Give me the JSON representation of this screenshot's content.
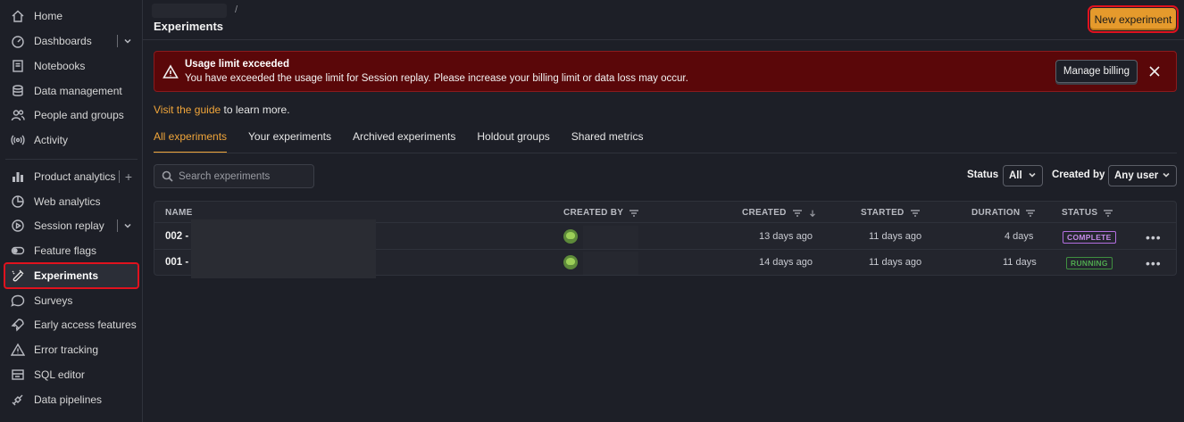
{
  "sidebar": {
    "items": [
      {
        "label": "Home",
        "icon": "home-icon"
      },
      {
        "label": "Dashboards",
        "icon": "dashboard-icon"
      },
      {
        "label": "Notebooks",
        "icon": "notebook-icon"
      },
      {
        "label": "Data management",
        "icon": "database-icon"
      },
      {
        "label": "People and groups",
        "icon": "people-icon"
      },
      {
        "label": "Activity",
        "icon": "activity-icon"
      },
      {
        "label": "Product analytics",
        "icon": "bar-chart-icon"
      },
      {
        "label": "Web analytics",
        "icon": "pie-chart-icon"
      },
      {
        "label": "Session replay",
        "icon": "play-icon"
      },
      {
        "label": "Feature flags",
        "icon": "toggle-icon"
      },
      {
        "label": "Experiments",
        "icon": "flask-icon"
      },
      {
        "label": "Surveys",
        "icon": "chat-icon"
      },
      {
        "label": "Early access features",
        "icon": "rocket-icon"
      },
      {
        "label": "Error tracking",
        "icon": "warning-icon"
      },
      {
        "label": "SQL editor",
        "icon": "sql-icon"
      },
      {
        "label": "Data pipelines",
        "icon": "pipeline-icon"
      }
    ]
  },
  "header": {
    "breadcrumb_sep": "/",
    "title": "Experiments",
    "new_button": "New experiment"
  },
  "alert": {
    "title": "Usage limit exceeded",
    "text": "You have exceeded the usage limit for Session replay. Please increase your billing limit or data loss may occur.",
    "button": "Manage billing"
  },
  "guide": {
    "link": "Visit the guide",
    "rest": " to learn more."
  },
  "tabs": [
    "All experiments",
    "Your experiments",
    "Archived experiments",
    "Holdout groups",
    "Shared metrics"
  ],
  "filters": {
    "search_placeholder": "Search experiments",
    "status_label": "Status",
    "status_value": "All",
    "created_by_label": "Created by",
    "created_by_value": "Any user"
  },
  "table": {
    "columns": [
      "NAME",
      "CREATED BY",
      "CREATED",
      "STARTED",
      "DURATION",
      "STATUS"
    ],
    "rows": [
      {
        "name": "002 -",
        "created": "13 days ago",
        "started": "11 days ago",
        "duration": "4 days",
        "status": "COMPLETE"
      },
      {
        "name": "001 -",
        "created": "14 days ago",
        "started": "11 days ago",
        "duration": "11 days",
        "status": "RUNNING"
      }
    ]
  },
  "colors": {
    "accent": "#f0a53a",
    "alert_bg": "#5a0709",
    "complete": "#c58be8",
    "running": "#4fa84f"
  }
}
